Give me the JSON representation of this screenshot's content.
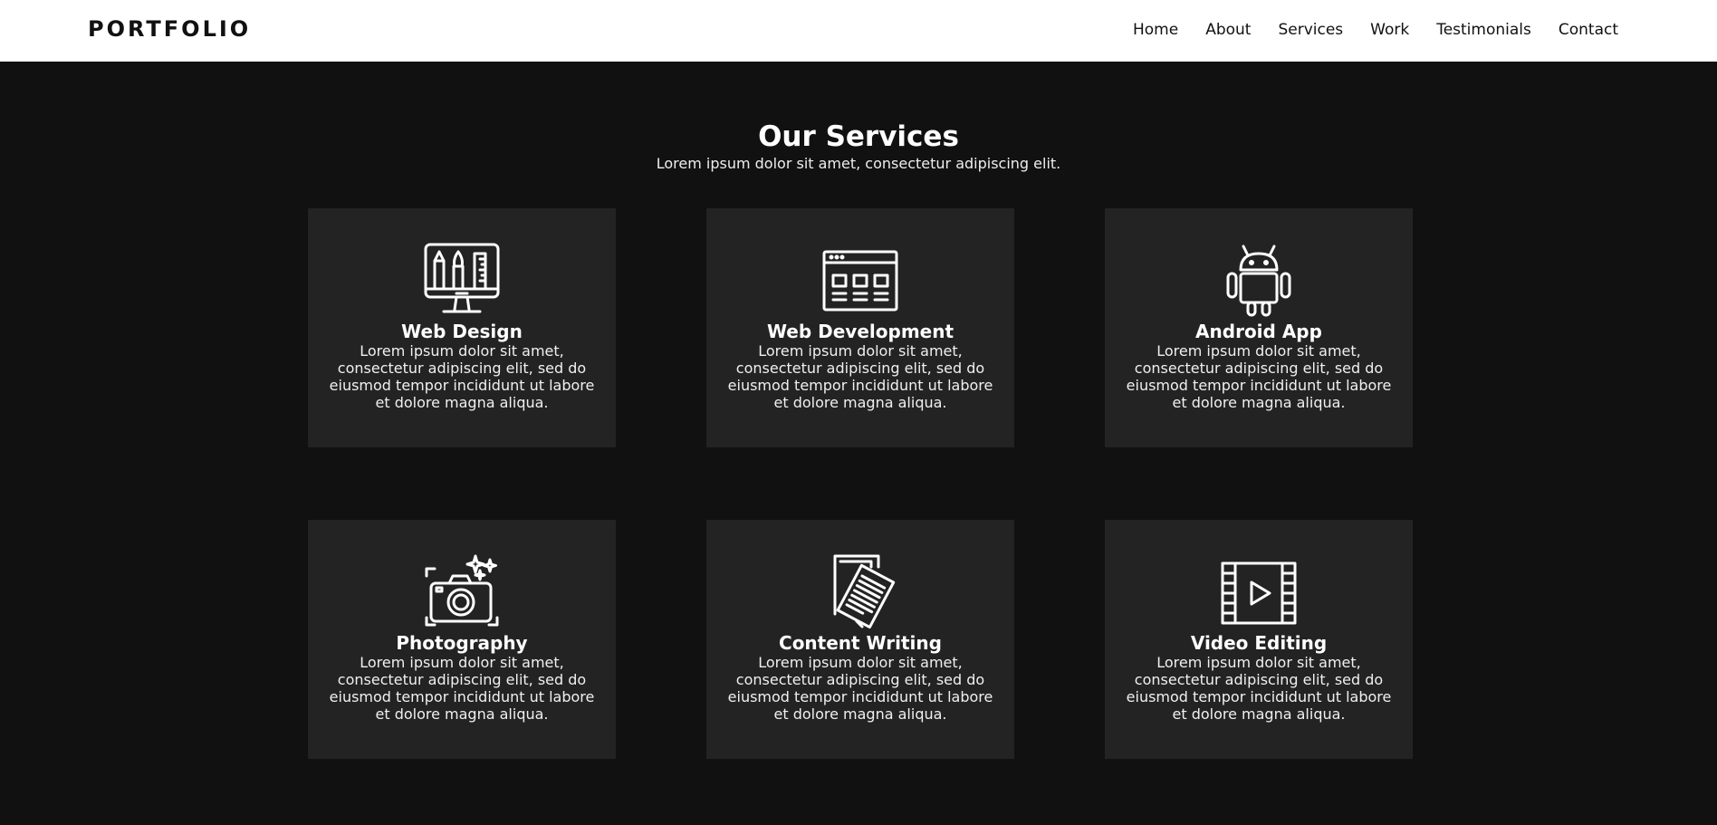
{
  "nav": {
    "logo": "PORTFOLIO",
    "links": [
      "Home",
      "About",
      "Services",
      "Work",
      "Testimonials",
      "Contact"
    ]
  },
  "services": {
    "title": "Our Services",
    "subtitle": "Lorem ipsum dolor sit amet, consectetur adipiscing elit.",
    "cards": [
      {
        "icon": "web-design-icon",
        "title": "Web Design",
        "desc": "Lorem ipsum dolor sit amet, consectetur adipiscing elit, sed do eiusmod tempor incididunt ut labore et dolore magna aliqua."
      },
      {
        "icon": "web-development-icon",
        "title": "Web Development",
        "desc": "Lorem ipsum dolor sit amet, consectetur adipiscing elit, sed do eiusmod tempor incididunt ut labore et dolore magna aliqua."
      },
      {
        "icon": "android-icon",
        "title": "Android App",
        "desc": "Lorem ipsum dolor sit amet, consectetur adipiscing elit, sed do eiusmod tempor incididunt ut labore et dolore magna aliqua."
      },
      {
        "icon": "camera-icon",
        "title": "Photography",
        "desc": "Lorem ipsum dolor sit amet, consectetur adipiscing elit, sed do eiusmod tempor incididunt ut labore et dolore magna aliqua."
      },
      {
        "icon": "document-icon",
        "title": "Content Writing",
        "desc": "Lorem ipsum dolor sit amet, consectetur adipiscing elit, sed do eiusmod tempor incididunt ut labore et dolore magna aliqua."
      },
      {
        "icon": "film-play-icon",
        "title": "Video Editing",
        "desc": "Lorem ipsum dolor sit amet, consectetur adipiscing elit, sed do eiusmod tempor incididunt ut labore et dolore magna aliqua."
      }
    ]
  },
  "colors": {
    "background": "#111111",
    "card": "#232323",
    "nav_background": "#ffffff",
    "text_light": "#ffffff",
    "text_dark": "#111111"
  }
}
